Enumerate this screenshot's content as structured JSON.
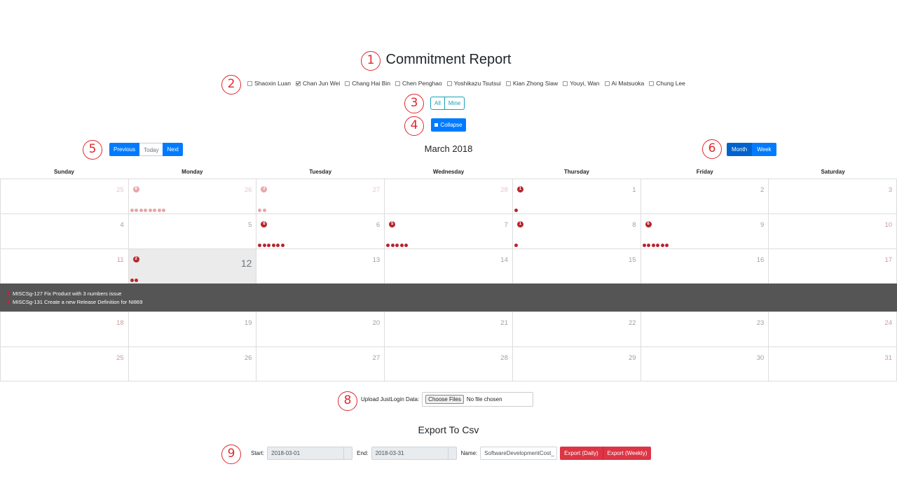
{
  "markers": [
    "1",
    "2",
    "3",
    "4",
    "5",
    "6",
    "7",
    "8",
    "9"
  ],
  "header": {
    "title": "Commitment Report"
  },
  "users": [
    {
      "name": "Shaoxin Luan",
      "checked": false
    },
    {
      "name": "Chan Jun Wei",
      "checked": true
    },
    {
      "name": "Chang Hai Bin",
      "checked": false
    },
    {
      "name": "Chen Penghao",
      "checked": false
    },
    {
      "name": "Yoshikazu Tsutsui",
      "checked": false
    },
    {
      "name": "Kian Zhong Siaw",
      "checked": false
    },
    {
      "name": "Youyi, Wan",
      "checked": false
    },
    {
      "name": "Ai Matsuoka",
      "checked": false
    },
    {
      "name": "Chung Lee",
      "checked": false
    }
  ],
  "filter": {
    "all_label": "All",
    "mine_label": "Mine"
  },
  "collapse": {
    "label": "Collapse"
  },
  "nav": {
    "previous": "Previous",
    "today": "Today",
    "next": "Next"
  },
  "calendar": {
    "month_title": "March 2018",
    "view_month": "Month",
    "view_week": "Week",
    "weekdays": [
      "Sunday",
      "Monday",
      "Tuesday",
      "Wednesday",
      "Thursday",
      "Friday",
      "Saturday"
    ],
    "weeks": [
      [
        {
          "d": "25",
          "o": true
        },
        {
          "d": "26",
          "o": true,
          "n": 8
        },
        {
          "d": "27",
          "o": true,
          "n": 2
        },
        {
          "d": "28",
          "o": true
        },
        {
          "d": "1",
          "n": 1
        },
        {
          "d": "2"
        },
        {
          "d": "3",
          "w": true
        }
      ],
      [
        {
          "d": "4"
        },
        {
          "d": "5"
        },
        {
          "d": "6",
          "n": 6
        },
        {
          "d": "7",
          "n": 5
        },
        {
          "d": "8",
          "n": 1
        },
        {
          "d": "9",
          "n": 6
        },
        {
          "d": "10",
          "w": true
        }
      ],
      [
        {
          "d": "11",
          "w": true
        },
        {
          "d": "12",
          "n": 2,
          "today": true
        },
        {
          "d": "13"
        },
        {
          "d": "14"
        },
        {
          "d": "15"
        },
        {
          "d": "16"
        },
        {
          "d": "17",
          "w": true
        }
      ],
      [
        {
          "d": "18",
          "w": true
        },
        {
          "d": "19"
        },
        {
          "d": "20"
        },
        {
          "d": "21"
        },
        {
          "d": "22"
        },
        {
          "d": "23"
        },
        {
          "d": "24",
          "w": true
        }
      ],
      [
        {
          "d": "25",
          "w": true
        },
        {
          "d": "26"
        },
        {
          "d": "27"
        },
        {
          "d": "28"
        },
        {
          "d": "29"
        },
        {
          "d": "30"
        },
        {
          "d": "31",
          "w": true
        }
      ]
    ],
    "expanded_events": [
      "MISCSg-127 Fix Product with 3 numbers issue",
      "MISCSg-131 Create a new Release Definition for NI869"
    ]
  },
  "upload": {
    "label": "Upload JustLogin Data:",
    "button": "Choose Files",
    "status": "No file chosen"
  },
  "export": {
    "title": "Export To Csv",
    "start_label": "Start:",
    "start_value": "2018-03-01",
    "end_label": "End:",
    "end_value": "2018-03-31",
    "name_label": "Name:",
    "name_value": "SoftwareDevelopmentCost_",
    "daily_label": "Export (Daily)",
    "weekly_label": "Export (Weekly)"
  }
}
